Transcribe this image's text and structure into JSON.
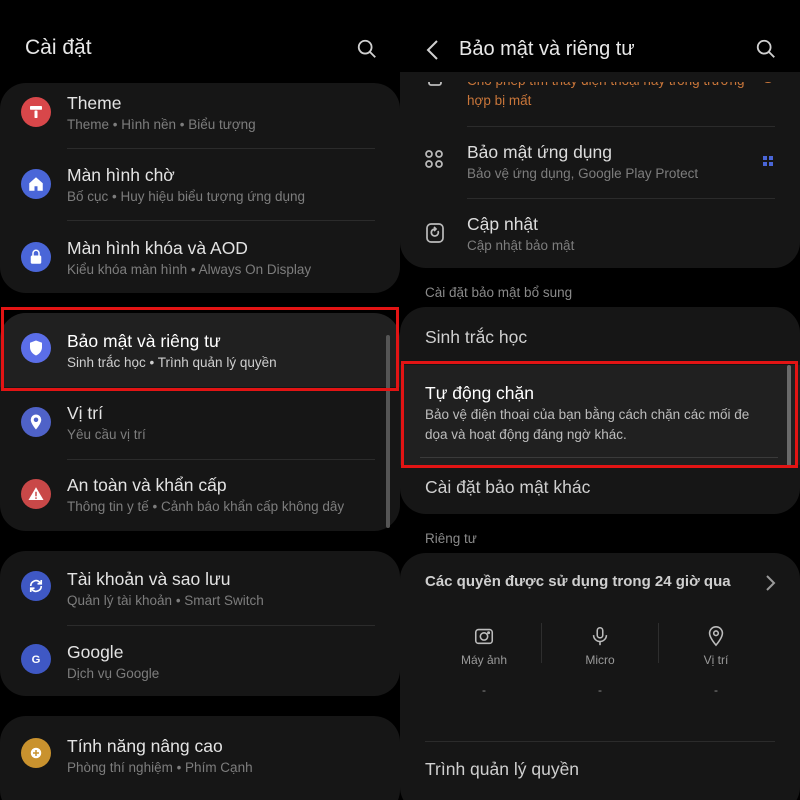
{
  "left": {
    "title": "Cài đặt",
    "groups": [
      {
        "items": [
          {
            "title": "Theme",
            "subtitle": "Theme • Hình nền • Biểu tượng",
            "icon": "theme-icon",
            "color": "#d8474a"
          },
          {
            "title": "Màn hình chờ",
            "subtitle": "Bố cục • Huy hiệu biểu tượng ứng dụng",
            "icon": "home-icon",
            "color": "#4a66d8"
          },
          {
            "title": "Màn hình khóa và AOD",
            "subtitle": "Kiểu khóa màn hình • Always On Display",
            "icon": "lock-icon",
            "color": "#4a66d8"
          }
        ]
      },
      {
        "items": [
          {
            "title": "Bảo mật và riêng tư",
            "subtitle": "Sinh trắc học • Trình quản lý quyền",
            "icon": "shield-icon",
            "color": "#5b6ee8"
          },
          {
            "title": "Vị trí",
            "subtitle": "Yêu cầu vị trí",
            "icon": "location-icon",
            "color": "#4f62c8"
          },
          {
            "title": "An toàn và khẩn cấp",
            "subtitle": "Thông tin y tế • Cảnh báo khẩn cấp không dây",
            "icon": "warning-icon",
            "color": "#c94848"
          }
        ]
      },
      {
        "items": [
          {
            "title": "Tài khoản và sao lưu",
            "subtitle": "Quản lý tài khoản • Smart Switch",
            "icon": "sync-icon",
            "color": "#3f58c4"
          },
          {
            "title": "Google",
            "subtitle": "Dịch vụ Google",
            "icon": "google-icon",
            "color": "#3f58c4"
          }
        ]
      },
      {
        "items": [
          {
            "title": "Tính năng nâng cao",
            "subtitle": "Phòng thí nghiệm • Phím Cạnh",
            "icon": "gear-plus-icon",
            "color": "#c9922e"
          }
        ]
      }
    ]
  },
  "right": {
    "title": "Bảo mật và riêng tư",
    "partial_text_line1": "Cho phép tìm thấy điện thoại hay trong trường",
    "partial_text_line2": "hợp bị mất",
    "items": [
      {
        "title": "Bảo mật ứng dụng",
        "subtitle": "Bảo vệ ứng dụng, Google Play Protect",
        "icon": "apps-grid-icon"
      },
      {
        "title": "Cập nhật",
        "subtitle": "Cập nhật bảo mật",
        "icon": "update-icon"
      }
    ],
    "extra_section_label": "Cài đặt bảo mật bổ sung",
    "biometrics": "Sinh trắc học",
    "auto_block": {
      "title": "Tự động chặn",
      "description": "Bảo vệ điện thoại của bạn bằng cách chặn các mối đe dọa và hoạt động đáng ngờ khác."
    },
    "other_security": "Cài đặt bảo mật khác",
    "privacy_label": "Riêng tư",
    "permissions_title": "Các quyền được sử dụng trong 24 giờ qua",
    "permissions": [
      {
        "label": "Máy ảnh",
        "icon": "camera-icon",
        "value": "-"
      },
      {
        "label": "Micro",
        "icon": "microphone-icon",
        "value": "-"
      },
      {
        "label": "Vị trí",
        "icon": "location-pin-icon",
        "value": "-"
      }
    ],
    "permission_manager": "Trình quản lý quyền"
  },
  "colors": {
    "background": "#000000",
    "card": "#161616",
    "highlight": "#e21414",
    "orange_text": "#c9763a"
  }
}
